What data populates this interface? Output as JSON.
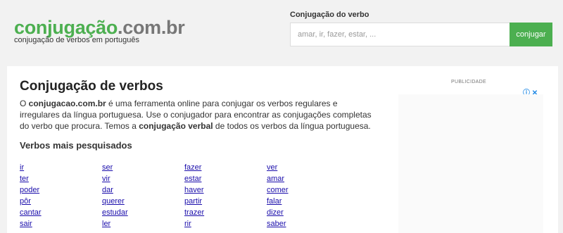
{
  "header": {
    "logo_brand": "conjugação",
    "logo_tld": ".com.br",
    "tagline": "conjugação de verbos em português"
  },
  "search": {
    "label": "Conjugação do verbo",
    "placeholder": "amar, ir, fazer, estar, ...",
    "button_label": "conjugar"
  },
  "main": {
    "title": "Conjugação de verbos",
    "intro_1": "O ",
    "intro_site": "conjugacao.com.br",
    "intro_2": " é uma ferramenta online para conjugar os verbos regulares e irregulares da língua portuguesa. Use o conjugador para encontrar as conjugações completas do verbo que procura. Temos a ",
    "intro_bold": "conjugação verbal",
    "intro_3": " de todos os verbos da língua portuguesa.",
    "section_title": "Verbos mais pesquisados",
    "verbs": [
      "ir",
      "ser",
      "fazer",
      "ver",
      "ter",
      "vir",
      "estar",
      "amar",
      "poder",
      "dar",
      "haver",
      "comer",
      "pôr",
      "querer",
      "partir",
      "falar",
      "cantar",
      "estudar",
      "trazer",
      "dizer",
      "sair",
      "ler",
      "rir",
      "saber"
    ]
  },
  "ad": {
    "label": "PUBLICIDADE",
    "icons": "ⓘ ✕"
  },
  "colors": {
    "brand_green": "#4caf50",
    "link_blue": "#1a0dab"
  }
}
